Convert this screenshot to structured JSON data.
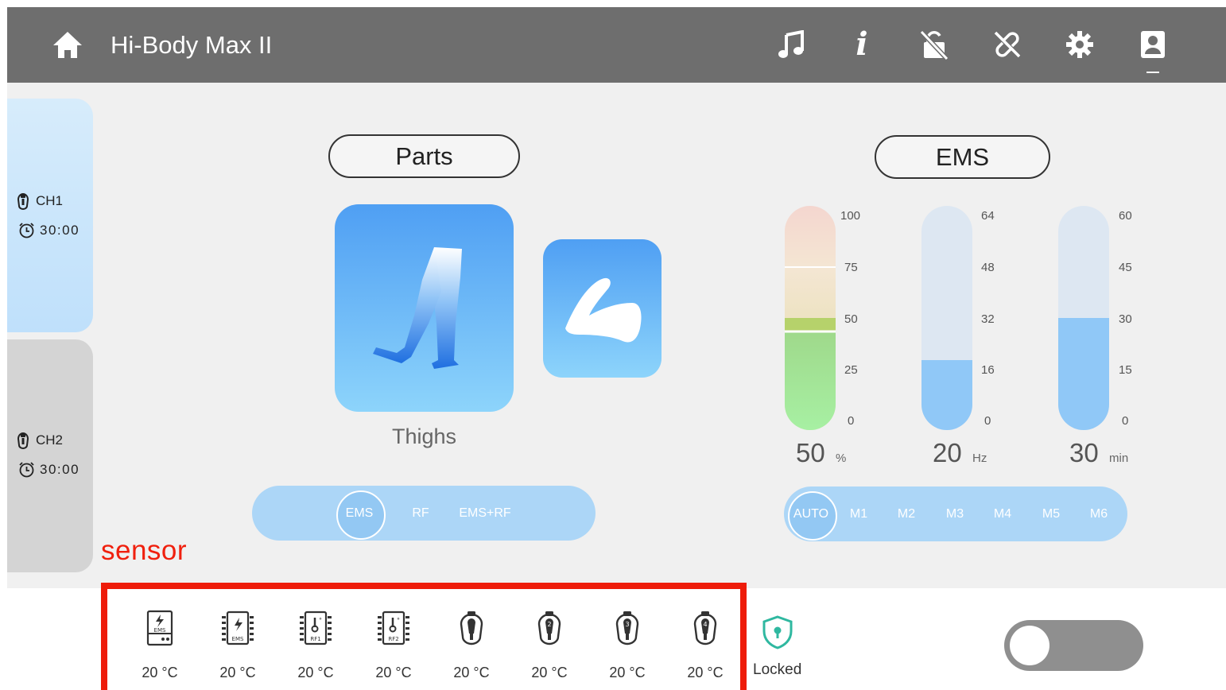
{
  "header": {
    "title": "Hi-Body Max II",
    "icons": [
      "home-icon",
      "music-icon",
      "info-icon",
      "lock-off-icon",
      "link-off-icon",
      "gear-icon",
      "user-icon"
    ],
    "info_glyph": "i"
  },
  "channels": [
    {
      "label": "CH1",
      "time": "30:00",
      "selected": true
    },
    {
      "label": "CH2",
      "time": "30:00",
      "selected": false
    }
  ],
  "parts": {
    "title": "Parts",
    "items": [
      {
        "name": "Thighs",
        "icon": "legs-icon",
        "selected": true
      },
      {
        "name": "Arms",
        "icon": "arm-icon",
        "selected": false
      }
    ],
    "selected_label": "Thighs",
    "modes": [
      "EMS",
      "RF",
      "EMS+RF"
    ],
    "selected_mode": "EMS"
  },
  "ems": {
    "title": "EMS",
    "gauges": [
      {
        "id": "intensity",
        "ticks": [
          "100",
          "75",
          "50",
          "25",
          "0"
        ],
        "max": 100,
        "value": 50,
        "value_label": "50",
        "unit": "%"
      },
      {
        "id": "frequency",
        "ticks": [
          "64",
          "48",
          "32",
          "16",
          "0"
        ],
        "max": 64,
        "value": 20,
        "value_label": "20",
        "unit": "Hz"
      },
      {
        "id": "duration",
        "ticks": [
          "60",
          "45",
          "30",
          "15",
          "0"
        ],
        "max": 60,
        "value": 30,
        "value_label": "30",
        "unit": "min"
      }
    ],
    "programs": [
      "AUTO",
      "M1",
      "M2",
      "M3",
      "M4",
      "M5",
      "M6"
    ],
    "selected_program": "AUTO"
  },
  "sensor": {
    "label": "sensor",
    "items": [
      {
        "icon": "ems-board-icon",
        "tag": "EMS",
        "temp": "20 °C"
      },
      {
        "icon": "ems-chip-icon",
        "tag": "EMS",
        "temp": "20 °C"
      },
      {
        "icon": "rf1-chip-icon",
        "tag": "RF1",
        "temp": "20 °C"
      },
      {
        "icon": "rf2-chip-icon",
        "tag": "RF2",
        "temp": "20 °C"
      },
      {
        "icon": "handle-1-icon",
        "tag": "",
        "temp": "20 °C"
      },
      {
        "icon": "handle-2-icon",
        "tag": "2",
        "temp": "20 °C"
      },
      {
        "icon": "handle-3-icon",
        "tag": "3",
        "temp": "20 °C"
      },
      {
        "icon": "handle-4-icon",
        "tag": "4",
        "temp": "20 °C"
      }
    ]
  },
  "lock": {
    "icon": "shield-lock-icon",
    "text": "Locked"
  },
  "toggle": {
    "state": "off"
  },
  "colors": {
    "header_bg": "#6e6e6e",
    "tile_blue": "#4f9ff3",
    "pill_blue": "#acd6f7",
    "gauge_fill": "#90c8f7",
    "sensor_highlight": "#ee1c0a"
  }
}
